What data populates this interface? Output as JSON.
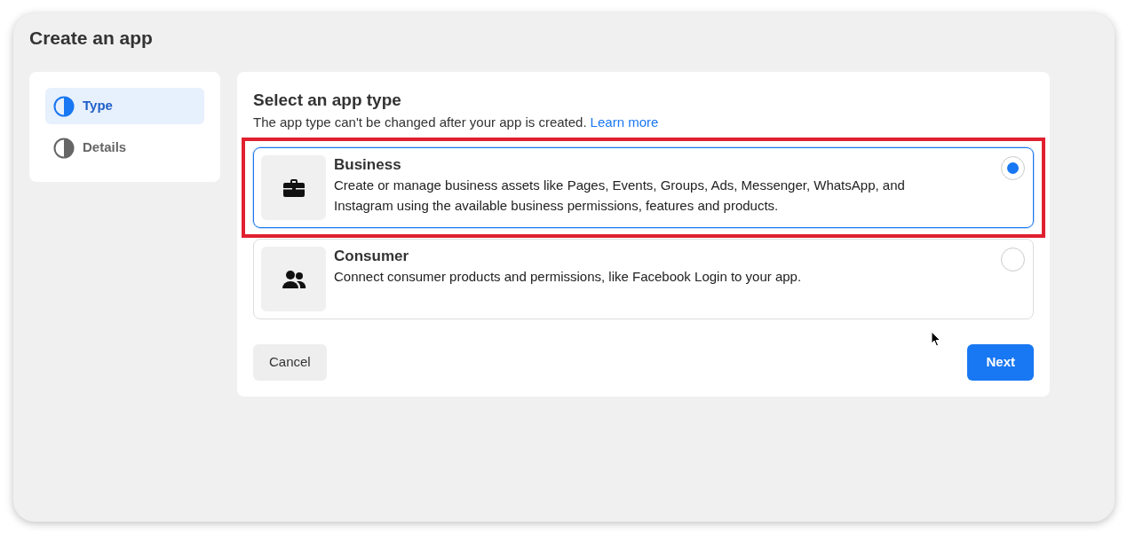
{
  "window": {
    "title": "Create an app"
  },
  "steps": [
    {
      "label": "Type",
      "selected": true
    },
    {
      "label": "Details",
      "selected": false
    }
  ],
  "panel": {
    "heading": "Select an app type",
    "subtitle": "The app type can't be changed after your app is created.",
    "link": "Learn more"
  },
  "options": [
    {
      "kind": "briefcase",
      "title": "Business",
      "description": "Create or manage business assets like Pages, Events, Groups, Ads, Messenger, WhatsApp, and Instagram using the available business permissions, features and products.",
      "selected": true,
      "highlighted": true
    },
    {
      "kind": "people",
      "title": "Consumer",
      "description": "Connect consumer products and permissions, like Facebook Login to your app.",
      "selected": false,
      "highlighted": false
    }
  ],
  "buttons": {
    "cancel": "Cancel",
    "next": "Next"
  }
}
